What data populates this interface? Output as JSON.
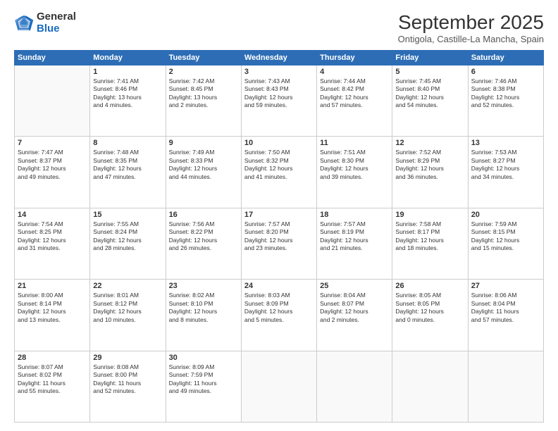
{
  "logo": {
    "general": "General",
    "blue": "Blue"
  },
  "title": "September 2025",
  "location": "Ontigola, Castille-La Mancha, Spain",
  "days_header": [
    "Sunday",
    "Monday",
    "Tuesday",
    "Wednesday",
    "Thursday",
    "Friday",
    "Saturday"
  ],
  "weeks": [
    [
      {
        "day": "",
        "info": ""
      },
      {
        "day": "1",
        "info": "Sunrise: 7:41 AM\nSunset: 8:46 PM\nDaylight: 13 hours\nand 4 minutes."
      },
      {
        "day": "2",
        "info": "Sunrise: 7:42 AM\nSunset: 8:45 PM\nDaylight: 13 hours\nand 2 minutes."
      },
      {
        "day": "3",
        "info": "Sunrise: 7:43 AM\nSunset: 8:43 PM\nDaylight: 12 hours\nand 59 minutes."
      },
      {
        "day": "4",
        "info": "Sunrise: 7:44 AM\nSunset: 8:42 PM\nDaylight: 12 hours\nand 57 minutes."
      },
      {
        "day": "5",
        "info": "Sunrise: 7:45 AM\nSunset: 8:40 PM\nDaylight: 12 hours\nand 54 minutes."
      },
      {
        "day": "6",
        "info": "Sunrise: 7:46 AM\nSunset: 8:38 PM\nDaylight: 12 hours\nand 52 minutes."
      }
    ],
    [
      {
        "day": "7",
        "info": "Sunrise: 7:47 AM\nSunset: 8:37 PM\nDaylight: 12 hours\nand 49 minutes."
      },
      {
        "day": "8",
        "info": "Sunrise: 7:48 AM\nSunset: 8:35 PM\nDaylight: 12 hours\nand 47 minutes."
      },
      {
        "day": "9",
        "info": "Sunrise: 7:49 AM\nSunset: 8:33 PM\nDaylight: 12 hours\nand 44 minutes."
      },
      {
        "day": "10",
        "info": "Sunrise: 7:50 AM\nSunset: 8:32 PM\nDaylight: 12 hours\nand 41 minutes."
      },
      {
        "day": "11",
        "info": "Sunrise: 7:51 AM\nSunset: 8:30 PM\nDaylight: 12 hours\nand 39 minutes."
      },
      {
        "day": "12",
        "info": "Sunrise: 7:52 AM\nSunset: 8:29 PM\nDaylight: 12 hours\nand 36 minutes."
      },
      {
        "day": "13",
        "info": "Sunrise: 7:53 AM\nSunset: 8:27 PM\nDaylight: 12 hours\nand 34 minutes."
      }
    ],
    [
      {
        "day": "14",
        "info": "Sunrise: 7:54 AM\nSunset: 8:25 PM\nDaylight: 12 hours\nand 31 minutes."
      },
      {
        "day": "15",
        "info": "Sunrise: 7:55 AM\nSunset: 8:24 PM\nDaylight: 12 hours\nand 28 minutes."
      },
      {
        "day": "16",
        "info": "Sunrise: 7:56 AM\nSunset: 8:22 PM\nDaylight: 12 hours\nand 26 minutes."
      },
      {
        "day": "17",
        "info": "Sunrise: 7:57 AM\nSunset: 8:20 PM\nDaylight: 12 hours\nand 23 minutes."
      },
      {
        "day": "18",
        "info": "Sunrise: 7:57 AM\nSunset: 8:19 PM\nDaylight: 12 hours\nand 21 minutes."
      },
      {
        "day": "19",
        "info": "Sunrise: 7:58 AM\nSunset: 8:17 PM\nDaylight: 12 hours\nand 18 minutes."
      },
      {
        "day": "20",
        "info": "Sunrise: 7:59 AM\nSunset: 8:15 PM\nDaylight: 12 hours\nand 15 minutes."
      }
    ],
    [
      {
        "day": "21",
        "info": "Sunrise: 8:00 AM\nSunset: 8:14 PM\nDaylight: 12 hours\nand 13 minutes."
      },
      {
        "day": "22",
        "info": "Sunrise: 8:01 AM\nSunset: 8:12 PM\nDaylight: 12 hours\nand 10 minutes."
      },
      {
        "day": "23",
        "info": "Sunrise: 8:02 AM\nSunset: 8:10 PM\nDaylight: 12 hours\nand 8 minutes."
      },
      {
        "day": "24",
        "info": "Sunrise: 8:03 AM\nSunset: 8:09 PM\nDaylight: 12 hours\nand 5 minutes."
      },
      {
        "day": "25",
        "info": "Sunrise: 8:04 AM\nSunset: 8:07 PM\nDaylight: 12 hours\nand 2 minutes."
      },
      {
        "day": "26",
        "info": "Sunrise: 8:05 AM\nSunset: 8:05 PM\nDaylight: 12 hours\nand 0 minutes."
      },
      {
        "day": "27",
        "info": "Sunrise: 8:06 AM\nSunset: 8:04 PM\nDaylight: 11 hours\nand 57 minutes."
      }
    ],
    [
      {
        "day": "28",
        "info": "Sunrise: 8:07 AM\nSunset: 8:02 PM\nDaylight: 11 hours\nand 55 minutes."
      },
      {
        "day": "29",
        "info": "Sunrise: 8:08 AM\nSunset: 8:00 PM\nDaylight: 11 hours\nand 52 minutes."
      },
      {
        "day": "30",
        "info": "Sunrise: 8:09 AM\nSunset: 7:59 PM\nDaylight: 11 hours\nand 49 minutes."
      },
      {
        "day": "",
        "info": ""
      },
      {
        "day": "",
        "info": ""
      },
      {
        "day": "",
        "info": ""
      },
      {
        "day": "",
        "info": ""
      }
    ]
  ]
}
